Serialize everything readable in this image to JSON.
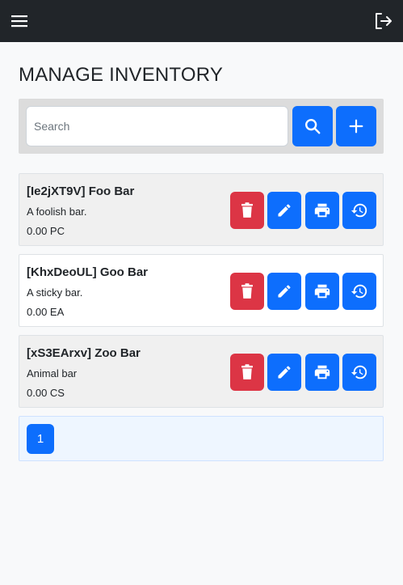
{
  "header": {
    "menu_icon": "hamburger-menu-icon",
    "logout_icon": "logout-icon"
  },
  "page": {
    "title": "MANAGE INVENTORY"
  },
  "search": {
    "placeholder": "Search",
    "value": "",
    "search_icon": "search-icon",
    "add_icon": "plus-icon"
  },
  "items": [
    {
      "title": "[Ie2jXT9V] Foo Bar",
      "description": "A foolish bar.",
      "quantity": "0.00 PC"
    },
    {
      "title": "[KhxDeoUL] Goo Bar",
      "description": "A sticky bar.",
      "quantity": "0.00 EA"
    },
    {
      "title": "[xS3EArxv] Zoo Bar",
      "description": "Animal bar",
      "quantity": "0.00 CS"
    }
  ],
  "item_actions": [
    "trash-icon",
    "pencil-icon",
    "printer-icon",
    "history-icon"
  ],
  "pagination": {
    "pages": [
      "1"
    ],
    "current": "1"
  },
  "colors": {
    "navbar": "#212529",
    "primary": "#0d6efd",
    "danger": "#dc3545",
    "background": "#f8f9fa"
  }
}
